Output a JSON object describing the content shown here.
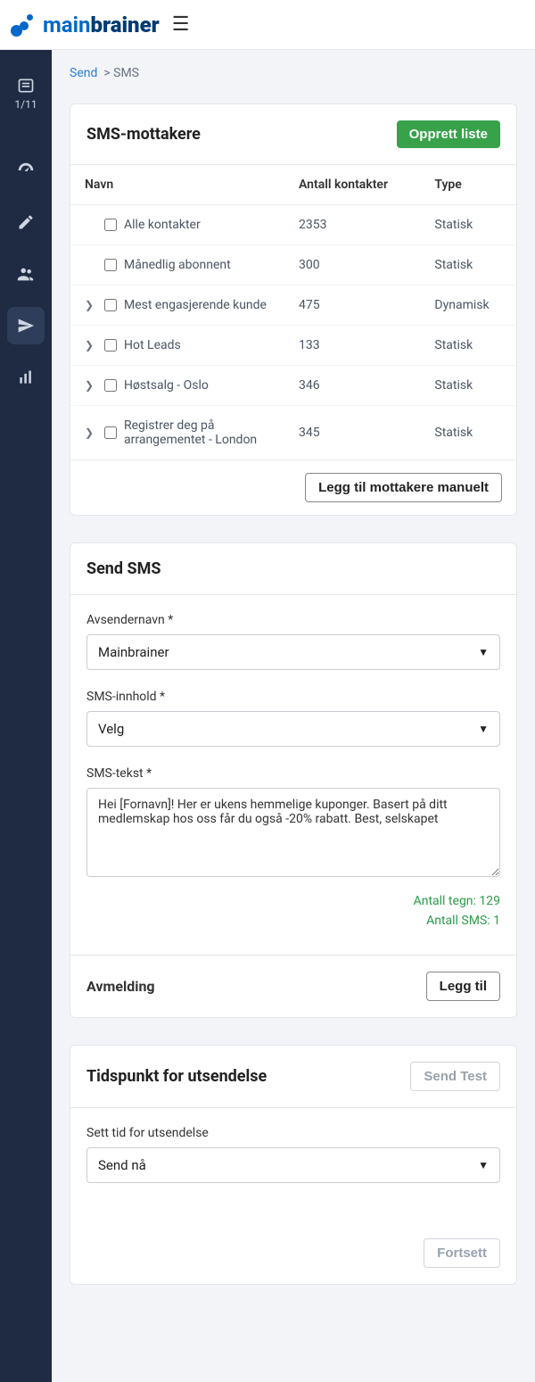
{
  "brand": {
    "first": "main",
    "second": "brainer"
  },
  "sidebar": {
    "progress": "1/11",
    "items": [
      {
        "icon": "dashboard"
      },
      {
        "icon": "pencil"
      },
      {
        "icon": "users"
      },
      {
        "icon": "send",
        "active": true
      },
      {
        "icon": "chart"
      }
    ]
  },
  "breadcrumb": {
    "root": "Send",
    "current": "SMS"
  },
  "recipients": {
    "title": "SMS-mottakere",
    "create_btn": "Opprett liste",
    "cols": {
      "name": "Navn",
      "contacts": "Antall kontakter",
      "type": "Type"
    },
    "rows": [
      {
        "name": "Alle kontakter",
        "contacts": "2353",
        "type": "Statisk",
        "expandable": false
      },
      {
        "name": "Månedlig abonnent",
        "contacts": "300",
        "type": "Statisk",
        "expandable": false
      },
      {
        "name": "Mest engasjerende kunde",
        "contacts": "475",
        "type": "Dynamisk",
        "expandable": true
      },
      {
        "name": "Hot Leads",
        "contacts": "133",
        "type": "Statisk",
        "expandable": true
      },
      {
        "name": "Høstsalg - Oslo",
        "contacts": "346",
        "type": "Statisk",
        "expandable": true
      },
      {
        "name": "Registrer deg på arrangementet - London",
        "contacts": "345",
        "type": "Statisk",
        "expandable": true
      }
    ],
    "add_manual": "Legg til mottakere manuelt"
  },
  "sendsms": {
    "title": "Send SMS",
    "sender_label": "Avsendernavn *",
    "sender_value": "Mainbrainer",
    "content_label": "SMS-innhold *",
    "content_value": "Velg",
    "text_label": "SMS-tekst *",
    "text_value": "Hei [Fornavn]! Her er ukens hemmelige kuponger. Basert på ditt medlemskap hos oss får du også -20% rabatt. Best, selskapet",
    "char_count": "Antall tegn: 129",
    "sms_count": "Antall SMS: 1",
    "unsub_title": "Avmelding",
    "unsub_btn": "Legg til"
  },
  "timing": {
    "title": "Tidspunkt for utsendelse",
    "send_test": "Send Test",
    "schedule_label": "Sett tid for utsendelse",
    "schedule_value": "Send nå",
    "continue_btn": "Fortsett"
  }
}
